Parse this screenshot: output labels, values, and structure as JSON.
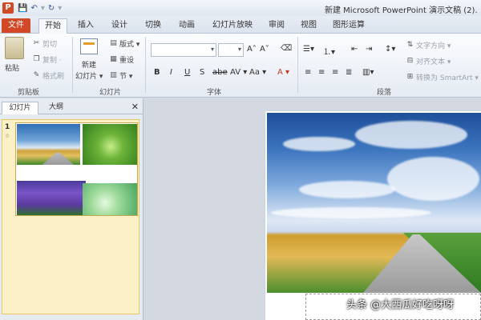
{
  "app": {
    "icon_letter": "P",
    "title": "新建 Microsoft PowerPoint 演示文稿 (2)."
  },
  "tabs": [
    {
      "label": "文件",
      "kind": "file"
    },
    {
      "label": "开始",
      "kind": "active"
    },
    {
      "label": "插入"
    },
    {
      "label": "设计"
    },
    {
      "label": "切换"
    },
    {
      "label": "动画"
    },
    {
      "label": "幻灯片放映"
    },
    {
      "label": "审阅"
    },
    {
      "label": "视图"
    },
    {
      "label": "图形运算"
    }
  ],
  "ribbon": {
    "clipboard": {
      "paste": "粘贴",
      "cut": "剪切",
      "copy": "复制 ·",
      "format_painter": "格式刷",
      "group": "剪贴板"
    },
    "slides": {
      "new_slide_1": "新建",
      "new_slide_2": "幻灯片 ▾",
      "layout": "版式 ▾",
      "reset": "重设",
      "section": "节 ▾",
      "group": "幻灯片"
    },
    "font": {
      "group": "字体",
      "bold": "B",
      "italic": "I",
      "underline": "U",
      "shadow": "S",
      "strike": "abe",
      "spacing": "AV ▾",
      "case": "Aa ▾",
      "color": "A ▾",
      "grow": "A˄",
      "shrink": "A˅"
    },
    "paragraph": {
      "group": "段落",
      "text_direction": "文字方向 ▾",
      "align_text": "对齐文本 ▾",
      "smartart": "转换为 SmartArt ▾"
    }
  },
  "panel": {
    "tab_slides": "幻灯片",
    "tab_outline": "大纲",
    "close": "✕",
    "slide_number": "1",
    "slide_star": "☆"
  },
  "watermark": "头条 @大西瓜好吃呀呀",
  "colors": {
    "file_tab": "#d24726",
    "selection": "#fcf0c6"
  }
}
